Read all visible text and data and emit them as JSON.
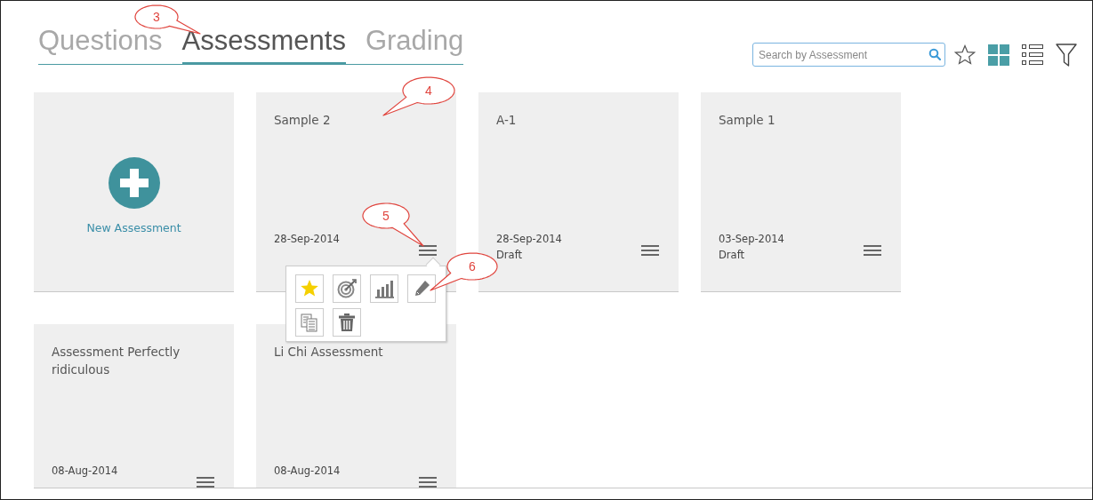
{
  "tabs": [
    {
      "label": "Questions",
      "selected": false
    },
    {
      "label": "Assessments",
      "selected": true
    },
    {
      "label": "Grading",
      "selected": false
    }
  ],
  "search": {
    "placeholder": "Search by Assessment"
  },
  "view_toggle": [
    {
      "kind": "grid",
      "selected": true
    },
    {
      "kind": "list",
      "selected": false
    }
  ],
  "cards": [
    {
      "kind": "new",
      "label": "New Assessment"
    },
    {
      "kind": "assessment",
      "title": "Sample 2",
      "date": "28-Sep-2014",
      "menu_open": true
    },
    {
      "kind": "assessment",
      "title": "A-1",
      "date": "28-Sep-2014",
      "status": "Draft"
    },
    {
      "kind": "assessment",
      "title": "Sample 1",
      "date": "03-Sep-2014",
      "status": "Draft"
    },
    {
      "kind": "assessment",
      "title": "Assessment Perfectly ridiculous",
      "date": "08-Aug-2014"
    },
    {
      "kind": "assessment",
      "title": "Li Chi Assessment",
      "date": "08-Aug-2014"
    }
  ],
  "callouts": [
    "3",
    "4",
    "5",
    "6"
  ]
}
